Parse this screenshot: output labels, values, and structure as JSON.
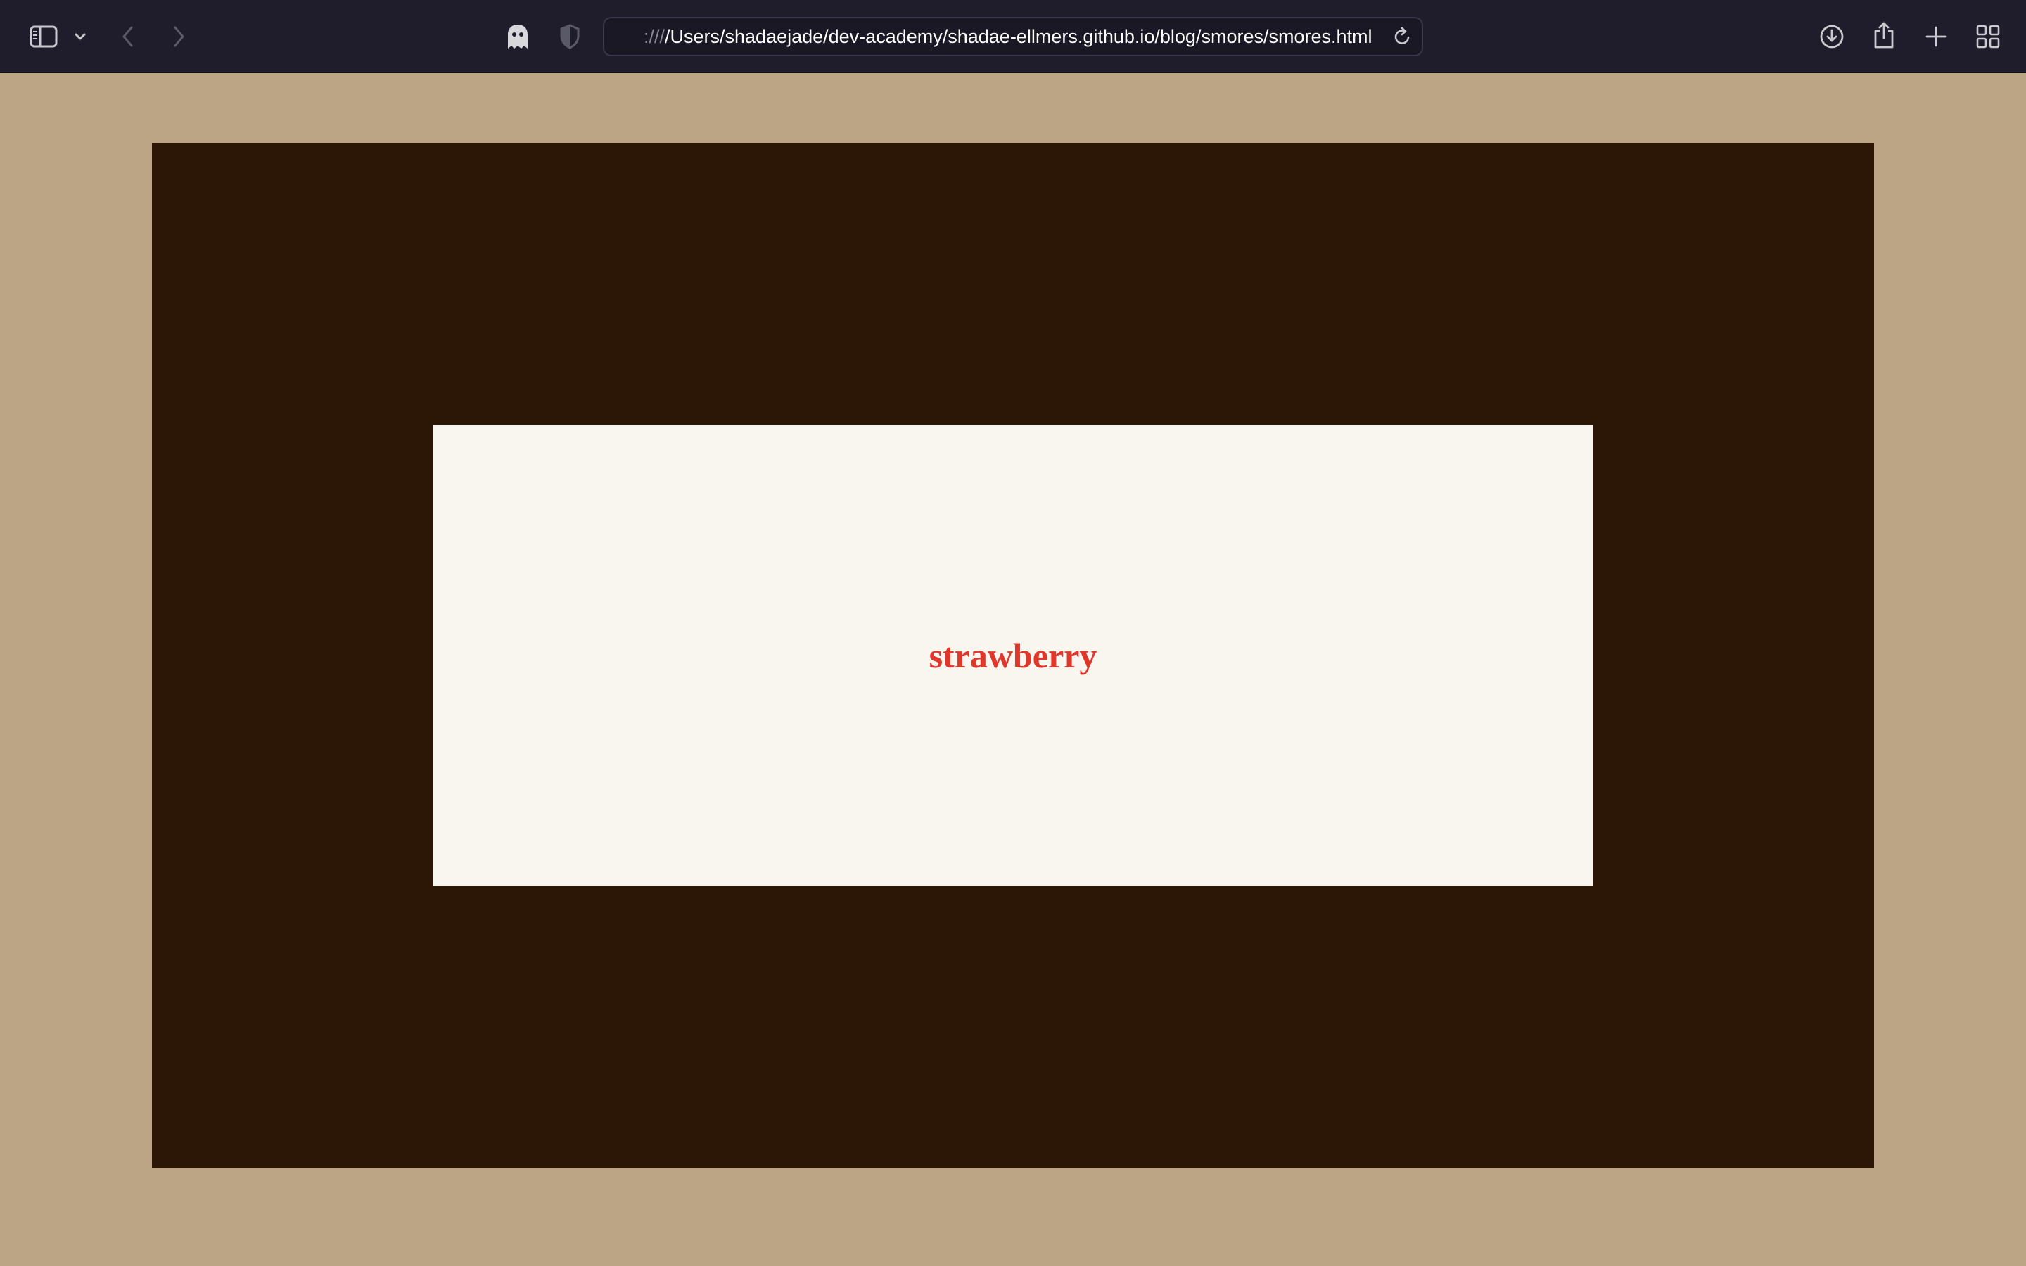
{
  "browser": {
    "address_bar": {
      "url_scheme": ":///",
      "url_path": "/Users/shadaejade/dev-academy/shadae-ellmers.github.io/blog/smores/smores.html"
    },
    "icons": {
      "sidebar": "sidebar-icon",
      "sidebar_menu": "chevron-down-icon",
      "back": "chevron-left-icon",
      "forward": "chevron-right-icon",
      "privacy": "ghost-icon",
      "shield": "shield-icon",
      "reload": "reload-icon",
      "downloads": "download-icon",
      "share": "share-icon",
      "new_tab": "plus-icon",
      "tab_overview": "grid-icon"
    }
  },
  "page": {
    "card_text": "strawberry",
    "colors": {
      "background": "#bca584",
      "frame": "#2c1606",
      "card": "#f9f6ef",
      "text": "#e0372b"
    }
  }
}
